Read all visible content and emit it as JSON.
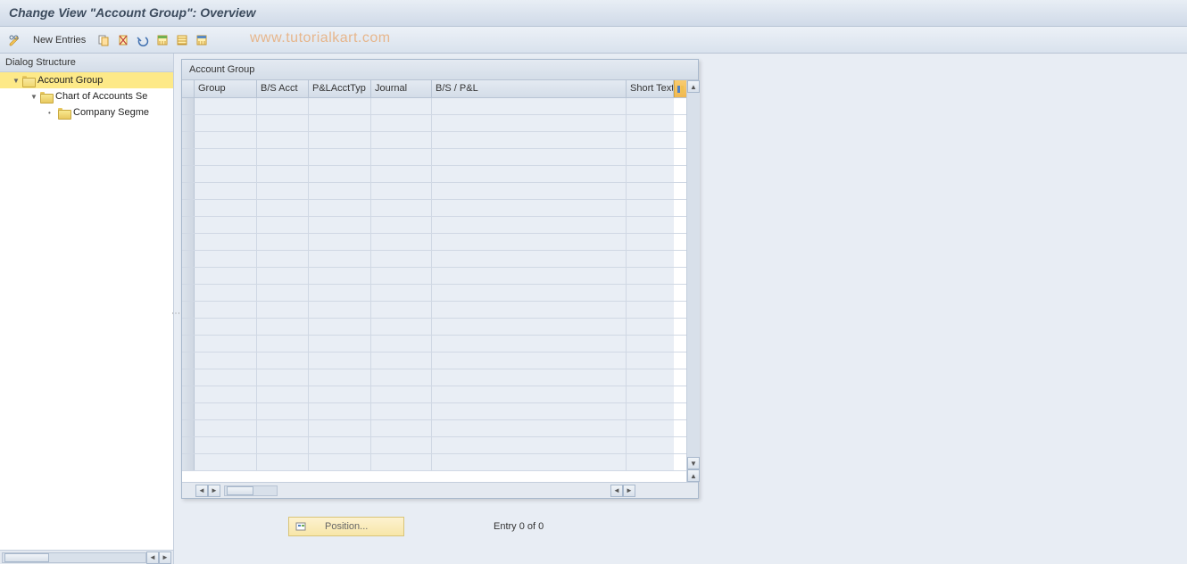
{
  "title": "Change View \"Account Group\": Overview",
  "watermark": "www.tutorialkart.com",
  "toolbar": {
    "new_entries": "New Entries"
  },
  "dialog_structure": {
    "header": "Dialog Structure",
    "nodes": [
      {
        "label": "Account Group",
        "level": 1,
        "selected": true,
        "expanded": true,
        "open_folder": true
      },
      {
        "label": "Chart of Accounts Se",
        "level": 2,
        "selected": false,
        "expanded": true,
        "open_folder": false
      },
      {
        "label": "Company Segme",
        "level": 3,
        "selected": false,
        "expanded": false,
        "open_folder": false
      }
    ]
  },
  "table": {
    "title": "Account Group",
    "columns": {
      "group": "Group",
      "bsacct": "B/S Acct",
      "pltype": "P&LAcctTyp",
      "journal": "Journal",
      "bspl": "B/S / P&L",
      "short": "Short Text"
    },
    "row_count": 22
  },
  "footer": {
    "position_label": "Position...",
    "entry_text": "Entry 0 of 0"
  }
}
